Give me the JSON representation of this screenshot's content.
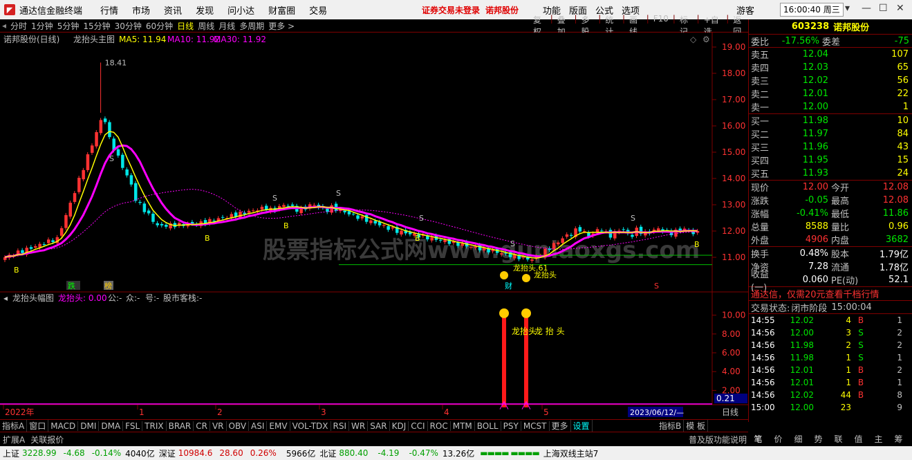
{
  "titlebar": {
    "app": "通达信金融终端",
    "menus": [
      "行情",
      "市场",
      "资讯",
      "发现",
      "问小达",
      "财富圈",
      "交易"
    ],
    "notice": "证券交易未登录",
    "stock": "诺邦股份",
    "right_menus": [
      "功能",
      "版面",
      "公式",
      "选项"
    ],
    "user": "游客",
    "time": "16:00:40 周三"
  },
  "toolbar": {
    "items": [
      "分时",
      "1分钟",
      "5分钟",
      "15分钟",
      "30分钟",
      "60分钟",
      "日线",
      "周线",
      "月线",
      "多周期",
      "更多 >"
    ],
    "active": "日线",
    "right_items": [
      "复权",
      "叠加",
      "多股",
      "统计",
      "画线",
      "F10",
      "标记",
      "+自选",
      "返回"
    ]
  },
  "main_chart": {
    "title": "诺邦股份(日线)",
    "formula": "龙抬头主图",
    "ma5_label": "MA5: 11.94",
    "ma10_label": "MA10: 11.92",
    "ma30_label": "MA30: 11.92",
    "high_label": "18.41",
    "watermark": "股票指标公式网www.gupiaoxgs.com",
    "labels": {
      "b": "B",
      "s": "S",
      "dragon": "龙抬头",
      "dragon61": "龙抬头.61",
      "cai": "财",
      "xie": "跌",
      "bang": "榜"
    },
    "y_ticks": [
      "19.00",
      "18.00",
      "17.00",
      "16.00",
      "15.00",
      "14.00",
      "13.00",
      "12.00",
      "11.00"
    ],
    "colors": {
      "up": "#ff3232",
      "down": "#00e6e6",
      "ma5": "#ffff00",
      "ma10": "#ff00ff",
      "ma30": "#ff00ff"
    }
  },
  "sub_chart": {
    "title": "龙抬头幅图",
    "label": "龙抬头: 0.00",
    "extras": [
      "公:-",
      "众:-",
      "号:-",
      "股市客栈:-"
    ],
    "y_ticks": [
      "10.00",
      "8.00",
      "6.00",
      "4.00",
      "2.00"
    ],
    "value": "0.21",
    "annot": "龙抬头",
    "annot2": "龙 抬 头"
  },
  "x_axis": {
    "labels": [
      "2022年",
      "1",
      "2",
      "3",
      "4",
      "5"
    ],
    "date_box": "2023/06/12/—",
    "period": "日线"
  },
  "indicators": {
    "items": [
      "指标A",
      "窗口",
      "MACD",
      "DMI",
      "DMA",
      "FSL",
      "TRIX",
      "BRAR",
      "CR",
      "VR",
      "OBV",
      "ASI",
      "EMV",
      "VOL-TDX",
      "RSI",
      "WR",
      "SAR",
      "KDJ",
      "CCI",
      "ROC",
      "MTM",
      "BOLL",
      "PSY",
      "MCST",
      "更多",
      "设置"
    ],
    "right": [
      "指标B",
      "模 板"
    ]
  },
  "subbar": {
    "items": [
      "扩展A",
      "关联报价"
    ],
    "right": "普及版功能说明"
  },
  "side": {
    "code": "603238",
    "name": "诺邦股份",
    "weibi_label": "委比",
    "weibi": "-17.56%",
    "weicha_label": "委差",
    "weicha": "-75",
    "asks": [
      {
        "l": "卖五",
        "p": "12.04",
        "v": "107"
      },
      {
        "l": "卖四",
        "p": "12.03",
        "v": "65"
      },
      {
        "l": "卖三",
        "p": "12.02",
        "v": "56"
      },
      {
        "l": "卖二",
        "p": "12.01",
        "v": "22"
      },
      {
        "l": "卖一",
        "p": "12.00",
        "v": "1"
      }
    ],
    "bids": [
      {
        "l": "买一",
        "p": "11.98",
        "v": "10"
      },
      {
        "l": "买二",
        "p": "11.97",
        "v": "84"
      },
      {
        "l": "买三",
        "p": "11.96",
        "v": "43"
      },
      {
        "l": "买四",
        "p": "11.95",
        "v": "15"
      },
      {
        "l": "买五",
        "p": "11.93",
        "v": "24"
      }
    ],
    "stats": [
      {
        "l1": "现价",
        "v1": "12.00",
        "c1": "red",
        "l2": "今开",
        "v2": "12.08",
        "c2": "red"
      },
      {
        "l1": "涨跌",
        "v1": "-0.05",
        "c1": "green",
        "l2": "最高",
        "v2": "12.08",
        "c2": "red"
      },
      {
        "l1": "涨幅",
        "v1": "-0.41%",
        "c1": "green",
        "l2": "最低",
        "v2": "11.86",
        "c2": "green"
      },
      {
        "l1": "总量",
        "v1": "8588",
        "c1": "yel",
        "l2": "量比",
        "v2": "0.96",
        "c2": "yel"
      },
      {
        "l1": "外盘",
        "v1": "4906",
        "c1": "red",
        "l2": "内盘",
        "v2": "3682",
        "c2": "green"
      }
    ],
    "stats2": [
      {
        "l1": "换手",
        "v1": "0.48%",
        "l2": "股本",
        "v2": "1.79亿"
      },
      {
        "l1": "净资",
        "v1": "7.28",
        "l2": "流通",
        "v2": "1.78亿"
      },
      {
        "l1": "收益(一)",
        "v1": "0.060",
        "l2": "PE(动)",
        "v2": "52.1"
      }
    ],
    "ad": "通达信，仅需20元查看千档行情",
    "status_label": "交易状态:",
    "status": "闭市阶段",
    "status_time": "15:00:04",
    "ticks": [
      {
        "t": "14:55",
        "p": "12.02",
        "v": "4",
        "d": "B",
        "n": "1"
      },
      {
        "t": "14:56",
        "p": "12.00",
        "v": "3",
        "d": "S",
        "n": "2"
      },
      {
        "t": "14:56",
        "p": "11.98",
        "v": "2",
        "d": "S",
        "n": "2"
      },
      {
        "t": "14:56",
        "p": "11.98",
        "v": "1",
        "d": "S",
        "n": "1"
      },
      {
        "t": "14:56",
        "p": "12.01",
        "v": "1",
        "d": "B",
        "n": "2"
      },
      {
        "t": "14:56",
        "p": "12.01",
        "v": "1",
        "d": "B",
        "n": "1"
      },
      {
        "t": "14:56",
        "p": "12.02",
        "v": "44",
        "d": "B",
        "n": "8"
      },
      {
        "t": "15:00",
        "p": "12.00",
        "v": "23",
        "d": "",
        "n": "9"
      }
    ],
    "tabs": [
      "笔",
      "价",
      "细",
      "势",
      "联",
      "值",
      "主",
      "筹"
    ]
  },
  "status": {
    "sh_label": "上证",
    "sh": "3228.99",
    "sh_chg": "-4.68",
    "sh_pct": "-0.14%",
    "sh_amt": "4040亿",
    "sz_label": "深证",
    "sz": "10984.6",
    "sz_chg": "28.60",
    "sz_pct": "0.26%",
    "sz_amt": "5966亿",
    "bz_label": "北证",
    "bz": "880.40",
    "bz_chg": "-4.19",
    "bz_pct": "-0.47%",
    "bz_amt": "13.26亿",
    "site": "上海双线主站7"
  }
}
